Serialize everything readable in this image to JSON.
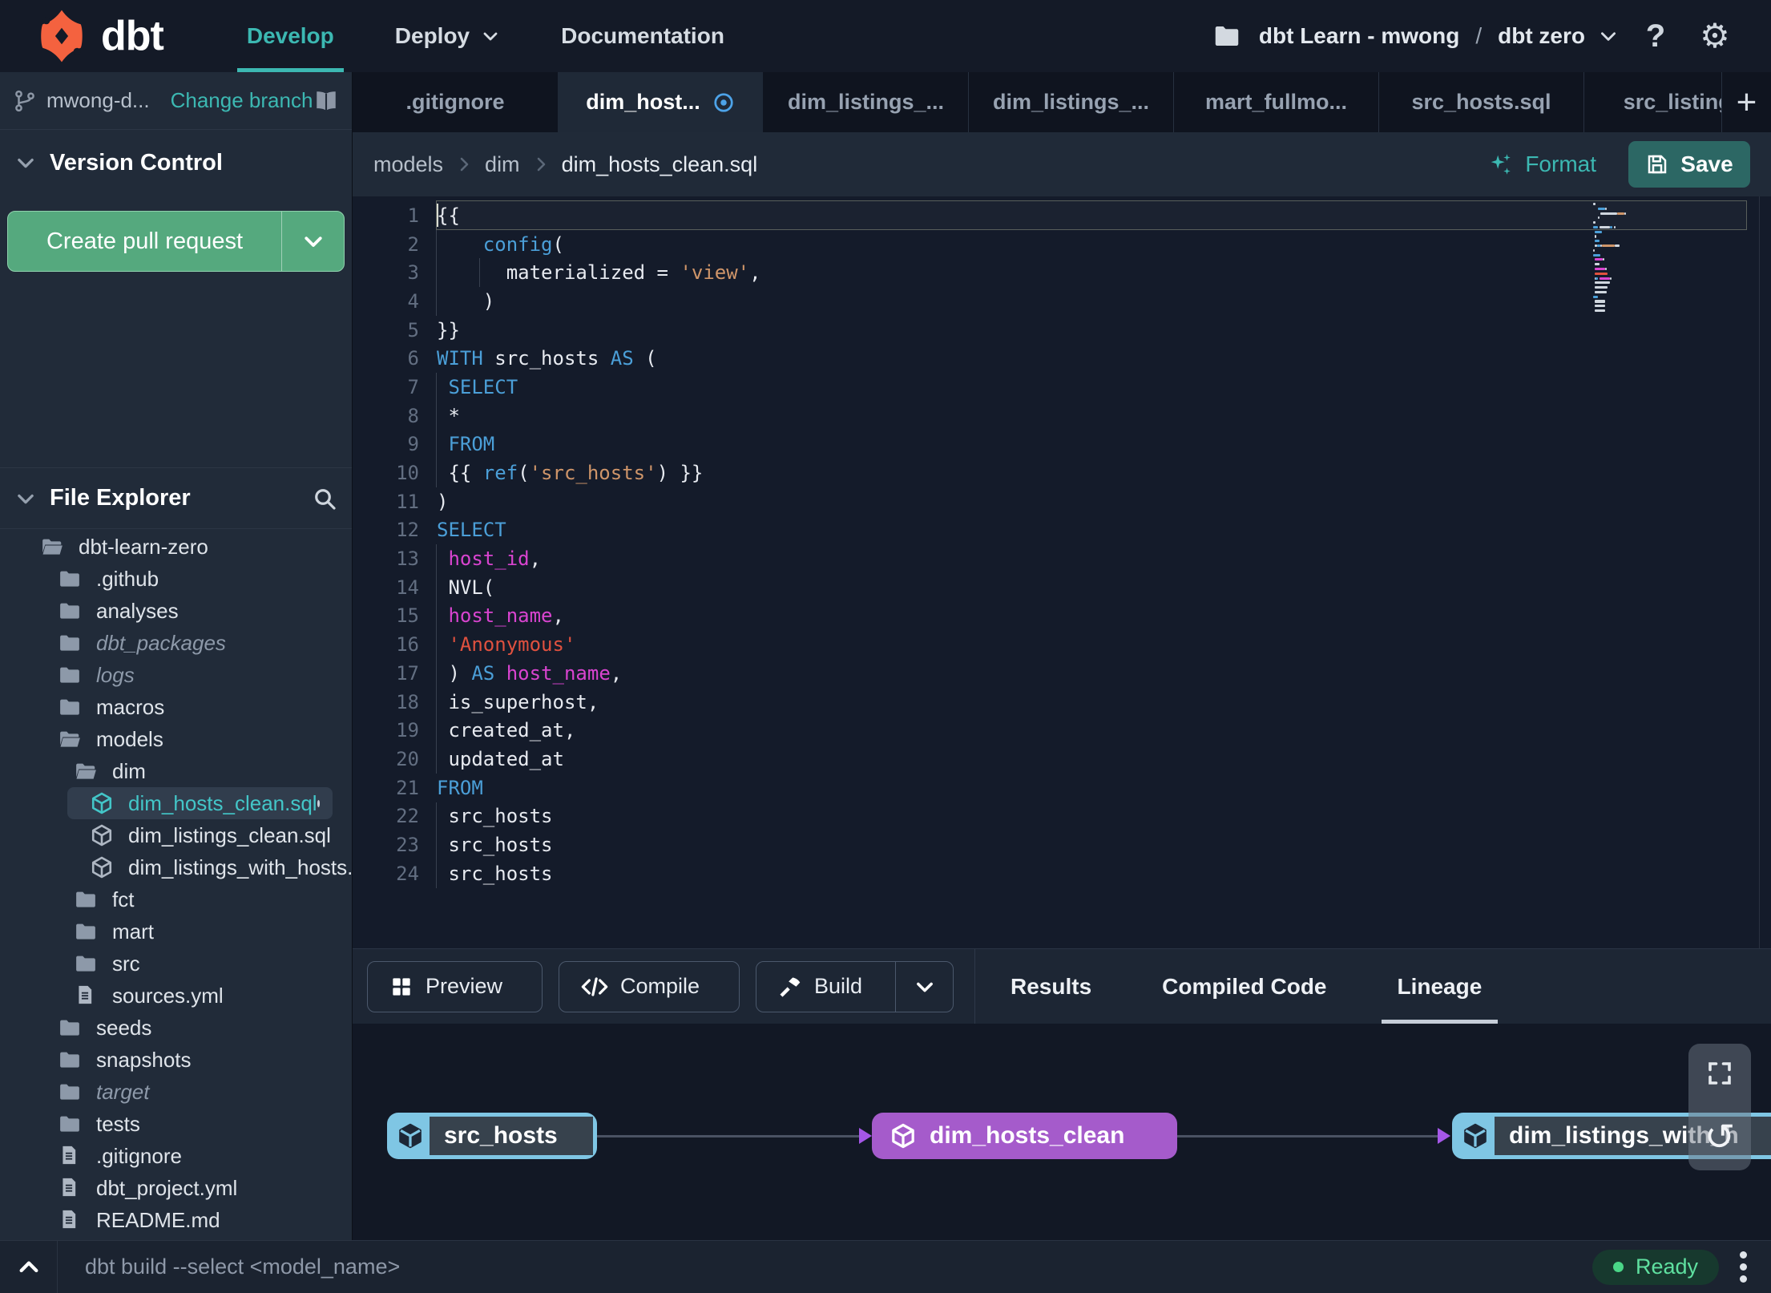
{
  "navbar": {
    "brand": "dbt",
    "items": [
      {
        "label": "Develop",
        "active": true,
        "chevron": false
      },
      {
        "label": "Deploy",
        "active": false,
        "chevron": true
      },
      {
        "label": "Documentation",
        "active": false,
        "chevron": false
      }
    ],
    "project": {
      "account": "dbt Learn - mwong",
      "separator": "/",
      "environment": "dbt zero"
    },
    "help_label": "?"
  },
  "sidebar": {
    "branch": {
      "name": "mwong-d...",
      "action": "Change branch"
    },
    "version_control": {
      "title": "Version Control",
      "button_label": "Create pull request"
    },
    "file_explorer": {
      "title": "File Explorer"
    },
    "tree": [
      {
        "name": "dbt-learn-zero",
        "icon": "folder-open",
        "level": 0
      },
      {
        "name": ".github",
        "icon": "folder",
        "level": 1
      },
      {
        "name": "analyses",
        "icon": "folder",
        "level": 1
      },
      {
        "name": "dbt_packages",
        "icon": "folder",
        "level": 1,
        "italic": true
      },
      {
        "name": "logs",
        "icon": "folder",
        "level": 1,
        "italic": true
      },
      {
        "name": "macros",
        "icon": "folder",
        "level": 1
      },
      {
        "name": "models",
        "icon": "folder-open",
        "level": 1
      },
      {
        "name": "dim",
        "icon": "folder-open",
        "level": 2
      },
      {
        "name": "dim_hosts_clean.sql",
        "icon": "cube",
        "level": 3,
        "selected": true,
        "modified": true
      },
      {
        "name": "dim_listings_clean.sql",
        "icon": "cube",
        "level": 3
      },
      {
        "name": "dim_listings_with_hosts...",
        "icon": "cube",
        "level": 3
      },
      {
        "name": "fct",
        "icon": "folder",
        "level": 2
      },
      {
        "name": "mart",
        "icon": "folder",
        "level": 2
      },
      {
        "name": "src",
        "icon": "folder",
        "level": 2
      },
      {
        "name": "sources.yml",
        "icon": "file",
        "level": 2
      },
      {
        "name": "seeds",
        "icon": "folder",
        "level": 1
      },
      {
        "name": "snapshots",
        "icon": "folder",
        "level": 1
      },
      {
        "name": "target",
        "icon": "folder",
        "level": 1,
        "italic": true
      },
      {
        "name": "tests",
        "icon": "folder",
        "level": 1
      },
      {
        "name": ".gitignore",
        "icon": "file",
        "level": 1
      },
      {
        "name": "dbt_project.yml",
        "icon": "file",
        "level": 1
      },
      {
        "name": "README.md",
        "icon": "file",
        "level": 1
      }
    ]
  },
  "tabs": [
    {
      "label": ".gitignore"
    },
    {
      "label": "dim_host...",
      "active": true,
      "unsaved": true
    },
    {
      "label": "dim_listings_..."
    },
    {
      "label": "dim_listings_..."
    },
    {
      "label": "mart_fullmo..."
    },
    {
      "label": "src_hosts.sql"
    },
    {
      "label": "src_listings."
    }
  ],
  "editor_header": {
    "breadcrumb": [
      "models",
      "dim",
      "dim_hosts_clean.sql"
    ],
    "format_label": "Format",
    "save_label": "Save"
  },
  "editor": {
    "lines": [
      [
        {
          "t": "{{",
          "c": "n"
        }
      ],
      [
        {
          "t": "    ",
          "c": "n"
        },
        {
          "t": "config",
          "c": "b"
        },
        {
          "t": "(",
          "c": "n"
        }
      ],
      [
        {
          "t": "      materialized = ",
          "c": "n"
        },
        {
          "t": "'view'",
          "c": "s"
        },
        {
          "t": ",",
          "c": "n"
        }
      ],
      [
        {
          "t": "    )",
          "c": "n"
        }
      ],
      [
        {
          "t": "}}",
          "c": "n"
        }
      ],
      [
        {
          "t": "WITH",
          "c": "b"
        },
        {
          "t": " src_hosts ",
          "c": "n"
        },
        {
          "t": "AS",
          "c": "b"
        },
        {
          "t": " (",
          "c": "n"
        }
      ],
      [
        {
          "t": " ",
          "c": "n"
        },
        {
          "t": "SELECT",
          "c": "b"
        }
      ],
      [
        {
          "t": " *",
          "c": "n"
        }
      ],
      [
        {
          "t": " ",
          "c": "n"
        },
        {
          "t": "FROM",
          "c": "b"
        }
      ],
      [
        {
          "t": " {{ ",
          "c": "n"
        },
        {
          "t": "ref",
          "c": "b"
        },
        {
          "t": "(",
          "c": "n"
        },
        {
          "t": "'src_hosts'",
          "c": "s"
        },
        {
          "t": ") }}",
          "c": "n"
        }
      ],
      [
        {
          "t": ")",
          "c": "n"
        }
      ],
      [
        {
          "t": "SELECT",
          "c": "b"
        }
      ],
      [
        {
          "t": " ",
          "c": "n"
        },
        {
          "t": "host_id",
          "c": "m"
        },
        {
          "t": ",",
          "c": "n"
        }
      ],
      [
        {
          "t": " NVL(",
          "c": "n"
        }
      ],
      [
        {
          "t": " ",
          "c": "n"
        },
        {
          "t": "host_name",
          "c": "m"
        },
        {
          "t": ",",
          "c": "n"
        }
      ],
      [
        {
          "t": " ",
          "c": "n"
        },
        {
          "t": "'Anonymous'",
          "c": "r"
        }
      ],
      [
        {
          "t": " ) ",
          "c": "n"
        },
        {
          "t": "AS",
          "c": "b"
        },
        {
          "t": " ",
          "c": "n"
        },
        {
          "t": "host_name",
          "c": "m"
        },
        {
          "t": ",",
          "c": "n"
        }
      ],
      [
        {
          "t": " is_superhost,",
          "c": "n"
        }
      ],
      [
        {
          "t": " created_at,",
          "c": "n"
        }
      ],
      [
        {
          "t": " updated_at",
          "c": "n"
        }
      ],
      [
        {
          "t": "FROM",
          "c": "b"
        }
      ],
      [
        {
          "t": " src_hosts",
          "c": "n"
        }
      ],
      [
        {
          "t": " src_hosts",
          "c": "n"
        }
      ],
      [
        {
          "t": " src_hosts",
          "c": "n"
        }
      ]
    ]
  },
  "bottom": {
    "buttons": [
      {
        "label": "Preview",
        "icon": "grid"
      },
      {
        "label": "Compile",
        "icon": "code"
      },
      {
        "label": "Build",
        "icon": "hammer",
        "split": true
      }
    ],
    "tabs": [
      {
        "label": "Results"
      },
      {
        "label": "Compiled Code"
      },
      {
        "label": "Lineage",
        "active": true
      }
    ]
  },
  "lineage": {
    "nodes": [
      {
        "label": "src_hosts",
        "style": "source"
      },
      {
        "label": "dim_hosts_clean",
        "style": "focus"
      },
      {
        "label": "dim_listings_with_h",
        "style": "source"
      }
    ]
  },
  "statusbar": {
    "command": "dbt build --select <model_name>",
    "status": "Ready"
  },
  "colors": {
    "teal": "#3cb8b2",
    "orange": "#f4623f",
    "green": "#55a97e",
    "purple": "#a55bcb",
    "node_blue": "#7fc6e4",
    "blue": "#4b9fd8",
    "string": "#cf9569",
    "red": "#e0513f",
    "magenta": "#d944d0",
    "ready_green": "#4ad687"
  }
}
